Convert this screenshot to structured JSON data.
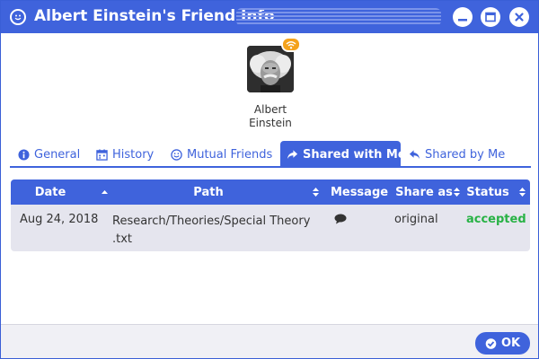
{
  "window": {
    "title": "Albert Einstein's Friend Info",
    "accent_color": "#3f63dc",
    "controls": [
      "minimize-icon",
      "maximize-icon",
      "close-icon"
    ]
  },
  "profile": {
    "first_name": "Albert",
    "last_name": "Einstein",
    "status_icon": "wifi-icon",
    "status_color": "#f4a21b"
  },
  "tabs": [
    {
      "label": "General",
      "icon": "info-icon",
      "active": false
    },
    {
      "label": "History",
      "icon": "calendar-icon",
      "active": false
    },
    {
      "label": "Mutual Friends",
      "icon": "smile-icon",
      "active": false
    },
    {
      "label": "Shared with Me",
      "icon": "share-icon",
      "active": true
    },
    {
      "label": "Shared by Me",
      "icon": "reply-icon",
      "active": false
    }
  ],
  "table": {
    "columns": [
      "Date",
      "Path",
      "Message",
      "Share as",
      "Status"
    ],
    "rows": [
      {
        "date": "Aug 24, 2018",
        "path_line1": "Research/Theories/Special Theory",
        "path_line2": ".txt",
        "message_icon": "comment-icon",
        "share_as": "original",
        "status": "accepted",
        "status_color": "#28b245"
      }
    ]
  },
  "footer": {
    "ok_label": "OK"
  }
}
